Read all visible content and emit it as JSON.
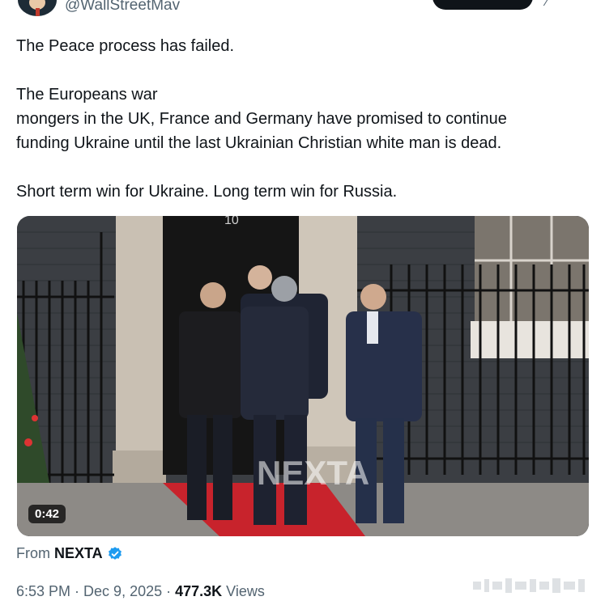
{
  "header": {
    "handle": "@WallStreetMav"
  },
  "tweet": {
    "paragraphs": [
      "The Peace process has failed.",
      "The Europeans war\nmongers in the UK, France and Germany have promised to continue\nfunding Ukraine until the last Ukrainian Christian white man is dead.",
      "Short term win for Ukraine. Long term win for Russia."
    ]
  },
  "media": {
    "duration": "0:42",
    "watermark_text": "NEXTA",
    "door_number": "10"
  },
  "source": {
    "prefix": "From",
    "name": "NEXTA"
  },
  "meta": {
    "time": "6:53 PM",
    "date": "Dec 9, 2025",
    "views_count": "477.3K",
    "views_label": "Views",
    "separator": "·"
  },
  "colors": {
    "text": "#0f1419",
    "secondary": "#536471",
    "verified": "#1d9bf0",
    "carpet": "#c8232c"
  }
}
